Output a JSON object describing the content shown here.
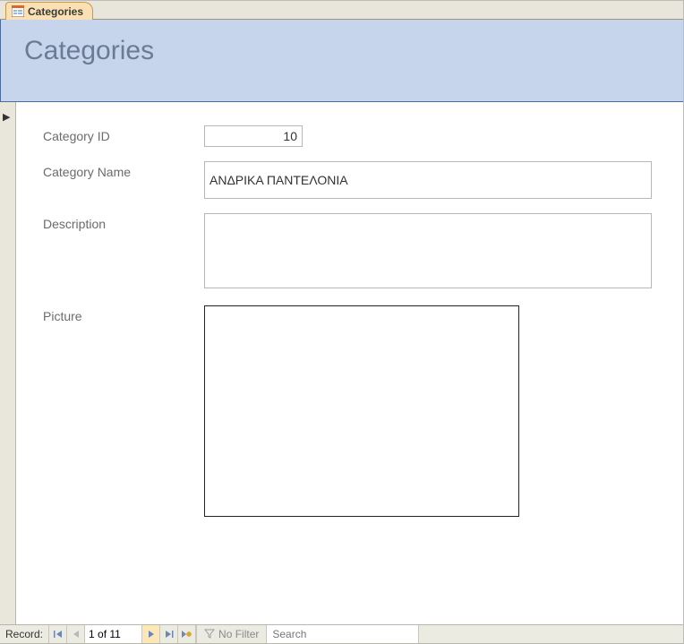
{
  "tab": {
    "label": "Categories"
  },
  "header": {
    "title": "Categories"
  },
  "form": {
    "labels": {
      "id": "Category ID",
      "name": "Category Name",
      "description": "Description",
      "picture": "Picture"
    },
    "values": {
      "id": "10",
      "name": "ΑΝΔΡΙΚΑ ΠΑΝΤΕΛΟΝΙΑ",
      "description": ""
    }
  },
  "nav": {
    "label": "Record:",
    "position": "1 of 11",
    "filter_label": "No Filter",
    "search_placeholder": "Search"
  }
}
